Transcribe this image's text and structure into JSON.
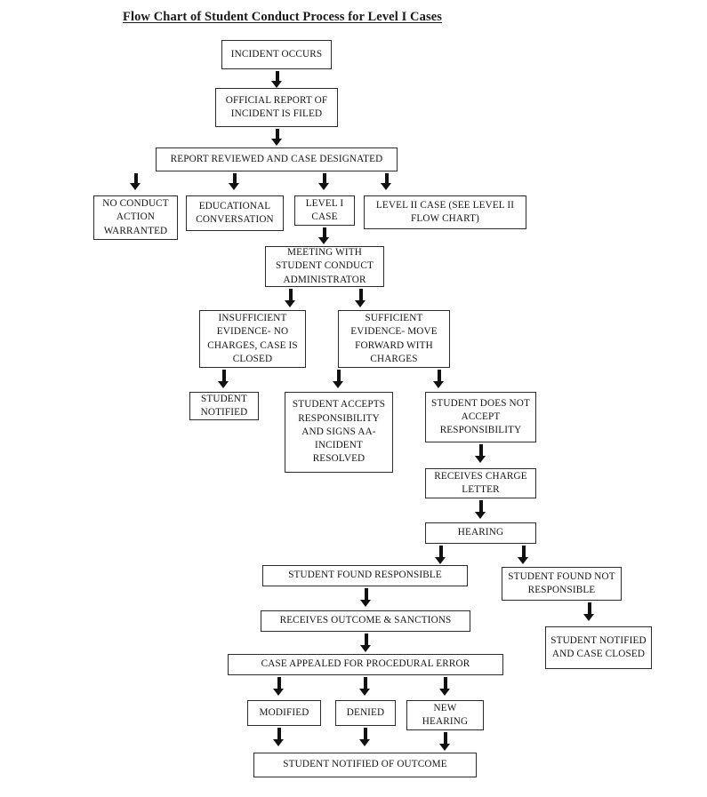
{
  "title": "Flow Chart of Student Conduct Process for Level I Cases",
  "nodes": {
    "incident_occurs": "INCIDENT OCCURS",
    "official_report": "OFFICIAL REPORT OF INCIDENT IS FILED",
    "report_reviewed": "REPORT REVIEWED AND CASE DESIGNATED",
    "no_conduct_action": "NO CONDUCT ACTION WARRANTED",
    "educational_conversation": "EDUCATIONAL CONVERSATION",
    "level_i_case": "LEVEL I CASE",
    "level_ii_case": "LEVEL II CASE (SEE LEVEL II FLOW CHART)",
    "meeting_with_administrator": "MEETING WITH STUDENT CONDUCT ADMINISTRATOR",
    "insufficient_evidence": "INSUFFICIENT EVIDENCE- NO CHARGES, CASE IS CLOSED",
    "sufficient_evidence": "SUFFICIENT EVIDENCE- MOVE FORWARD WITH CHARGES",
    "student_notified": "STUDENT NOTIFIED",
    "student_accepts": "STUDENT ACCEPTS RESPONSIBILITY AND SIGNS AA- INCIDENT RESOLVED",
    "student_does_not_accept": "STUDENT DOES NOT ACCEPT RESPONSIBILITY",
    "receives_charge_letter": "RECEIVES CHARGE LETTER",
    "hearing": "HEARING",
    "found_responsible": "STUDENT FOUND RESPONSIBLE",
    "found_not_responsible": "STUDENT FOUND NOT RESPONSIBLE",
    "receives_outcome": "RECEIVES OUTCOME & SANCTIONS",
    "notified_case_closed": "STUDENT NOTIFIED AND CASE CLOSED",
    "case_appealed": "CASE APPEALED FOR PROCEDURAL ERROR",
    "modified": "MODIFIED",
    "denied": "DENIED",
    "new_hearing": "NEW HEARING",
    "notified_of_outcome": "STUDENT NOTIFIED OF OUTCOME"
  },
  "chart_data": {
    "type": "diagram",
    "diagram_type": "flowchart",
    "title": "Flow Chart of Student Conduct Process for Level I Cases",
    "orientation": "top-to-bottom",
    "node_list": [
      {
        "id": "incident_occurs",
        "label": "INCIDENT OCCURS",
        "level": 0
      },
      {
        "id": "official_report",
        "label": "OFFICIAL REPORT OF INCIDENT IS FILED",
        "level": 1
      },
      {
        "id": "report_reviewed",
        "label": "REPORT REVIEWED AND CASE DESIGNATED",
        "level": 2
      },
      {
        "id": "no_conduct_action",
        "label": "NO CONDUCT ACTION WARRANTED",
        "level": 3
      },
      {
        "id": "educational_conversation",
        "label": "EDUCATIONAL CONVERSATION",
        "level": 3
      },
      {
        "id": "level_i_case",
        "label": "LEVEL I CASE",
        "level": 3
      },
      {
        "id": "level_ii_case",
        "label": "LEVEL II CASE (SEE LEVEL II FLOW CHART)",
        "level": 3
      },
      {
        "id": "meeting_with_administrator",
        "label": "MEETING WITH STUDENT CONDUCT ADMINISTRATOR",
        "level": 4
      },
      {
        "id": "insufficient_evidence",
        "label": "INSUFFICIENT EVIDENCE- NO CHARGES, CASE IS CLOSED",
        "level": 5
      },
      {
        "id": "sufficient_evidence",
        "label": "SUFFICIENT EVIDENCE- MOVE FORWARD WITH CHARGES",
        "level": 5
      },
      {
        "id": "student_notified",
        "label": "STUDENT NOTIFIED",
        "level": 6
      },
      {
        "id": "student_accepts",
        "label": "STUDENT ACCEPTS RESPONSIBILITY AND SIGNS AA- INCIDENT RESOLVED",
        "level": 6
      },
      {
        "id": "student_does_not_accept",
        "label": "STUDENT DOES NOT ACCEPT RESPONSIBILITY",
        "level": 6
      },
      {
        "id": "receives_charge_letter",
        "label": "RECEIVES CHARGE LETTER",
        "level": 7
      },
      {
        "id": "hearing",
        "label": "HEARING",
        "level": 8
      },
      {
        "id": "found_responsible",
        "label": "STUDENT FOUND RESPONSIBLE",
        "level": 9
      },
      {
        "id": "found_not_responsible",
        "label": "STUDENT FOUND NOT RESPONSIBLE",
        "level": 9
      },
      {
        "id": "receives_outcome",
        "label": "RECEIVES OUTCOME & SANCTIONS",
        "level": 10
      },
      {
        "id": "notified_case_closed",
        "label": "STUDENT NOTIFIED AND CASE CLOSED",
        "level": 10
      },
      {
        "id": "case_appealed",
        "label": "CASE APPEALED FOR PROCEDURAL ERROR",
        "level": 11
      },
      {
        "id": "modified",
        "label": "MODIFIED",
        "level": 12
      },
      {
        "id": "denied",
        "label": "DENIED",
        "level": 12
      },
      {
        "id": "new_hearing",
        "label": "NEW HEARING",
        "level": 12
      },
      {
        "id": "notified_of_outcome",
        "label": "STUDENT NOTIFIED OF OUTCOME",
        "level": 13
      }
    ],
    "edges": [
      {
        "from": "incident_occurs",
        "to": "official_report"
      },
      {
        "from": "official_report",
        "to": "report_reviewed"
      },
      {
        "from": "report_reviewed",
        "to": "no_conduct_action"
      },
      {
        "from": "report_reviewed",
        "to": "educational_conversation"
      },
      {
        "from": "report_reviewed",
        "to": "level_i_case"
      },
      {
        "from": "report_reviewed",
        "to": "level_ii_case"
      },
      {
        "from": "level_i_case",
        "to": "meeting_with_administrator"
      },
      {
        "from": "meeting_with_administrator",
        "to": "insufficient_evidence"
      },
      {
        "from": "meeting_with_administrator",
        "to": "sufficient_evidence"
      },
      {
        "from": "insufficient_evidence",
        "to": "student_notified"
      },
      {
        "from": "sufficient_evidence",
        "to": "student_accepts"
      },
      {
        "from": "sufficient_evidence",
        "to": "student_does_not_accept"
      },
      {
        "from": "student_does_not_accept",
        "to": "receives_charge_letter"
      },
      {
        "from": "receives_charge_letter",
        "to": "hearing"
      },
      {
        "from": "hearing",
        "to": "found_responsible"
      },
      {
        "from": "hearing",
        "to": "found_not_responsible"
      },
      {
        "from": "found_responsible",
        "to": "receives_outcome"
      },
      {
        "from": "found_not_responsible",
        "to": "notified_case_closed"
      },
      {
        "from": "receives_outcome",
        "to": "case_appealed"
      },
      {
        "from": "case_appealed",
        "to": "modified"
      },
      {
        "from": "case_appealed",
        "to": "denied"
      },
      {
        "from": "case_appealed",
        "to": "new_hearing"
      },
      {
        "from": "modified",
        "to": "notified_of_outcome"
      },
      {
        "from": "denied",
        "to": "notified_of_outcome"
      },
      {
        "from": "new_hearing",
        "to": "notified_of_outcome"
      }
    ],
    "colors": {
      "background": "#ffffff",
      "node_border": "#2b2b2b",
      "node_fill": "#ffffff",
      "text": "#141414",
      "arrow": "#111111"
    }
  }
}
